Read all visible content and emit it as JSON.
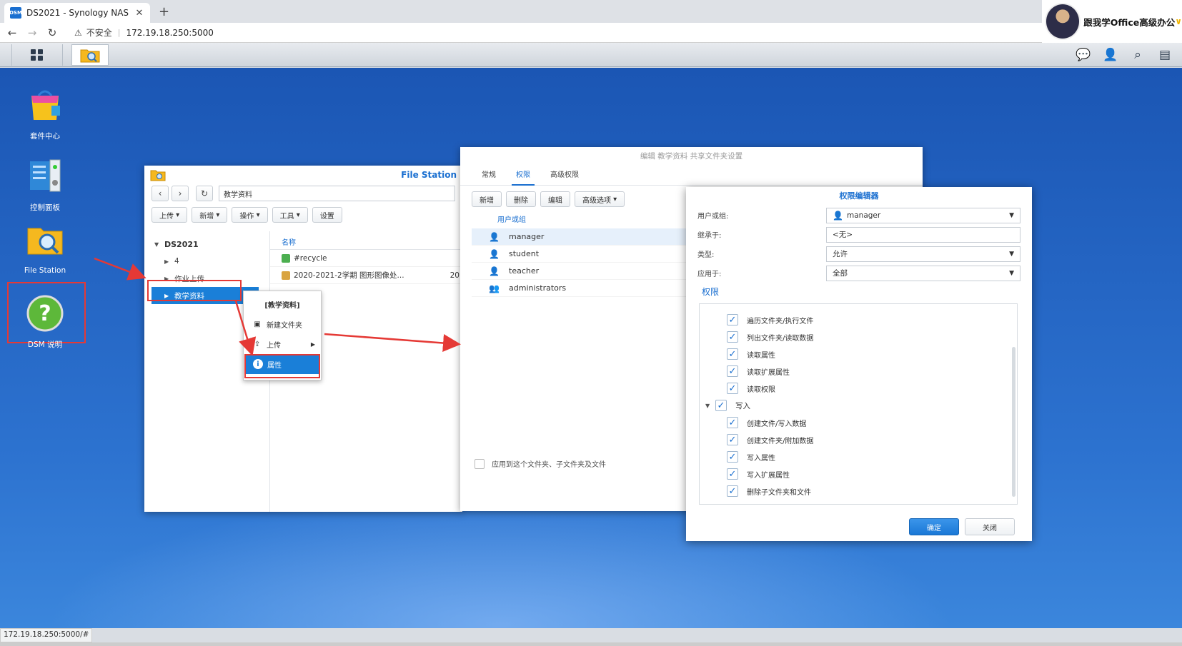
{
  "browser": {
    "tab_title": "DS2021 - Synology NAS",
    "favicon_text": "DSM",
    "insecure_label": "不安全",
    "url": "172.19.18.250:5000",
    "status_url": "172.19.18.250:5000/#"
  },
  "profile": {
    "name": "跟我学Office高级办公"
  },
  "desktop": {
    "icons": [
      {
        "label": "套件中心"
      },
      {
        "label": "控制面板"
      },
      {
        "label": "File Station"
      },
      {
        "label": "DSM 说明"
      }
    ]
  },
  "file_station": {
    "title": "File Station",
    "path": "教学资料",
    "toolbar": [
      "上传",
      "新增",
      "操作",
      "工具",
      "设置"
    ],
    "tree": {
      "root": "DS2021",
      "children": [
        "4",
        "作业上传",
        "教学资料"
      ]
    },
    "column_name": "名称",
    "files": [
      {
        "name": "#recycle"
      },
      {
        "name": "2020-2021-2学期 图形图像处...",
        "extra": "20"
      }
    ]
  },
  "context_menu": {
    "title": "[教学资料]",
    "items": [
      "新建文件夹",
      "上传",
      "属性"
    ]
  },
  "settings": {
    "title": "编辑 教学资料 共享文件夹设置",
    "tabs": [
      "常规",
      "权限",
      "高级权限"
    ],
    "toolbar": [
      "新增",
      "删除",
      "编辑",
      "高级选项"
    ],
    "list_header": "用户或组",
    "users": [
      "manager",
      "student",
      "teacher",
      "administrators"
    ],
    "apply_label": "应用到这个文件夹、子文件夹及文件"
  },
  "perm_editor": {
    "title": "权限编辑器",
    "fields": [
      {
        "label": "用户或组:",
        "value": "manager"
      },
      {
        "label": "继承于:",
        "value": "<无>"
      },
      {
        "label": "类型:",
        "value": "允许"
      },
      {
        "label": "应用于:",
        "value": "全部"
      }
    ],
    "section": "权限",
    "read_items": [
      "遍历文件夹/执行文件",
      "列出文件夹/读取数据",
      "读取属性",
      "读取扩展属性",
      "读取权限"
    ],
    "write_group": "写入",
    "write_items": [
      "创建文件/写入数据",
      "创建文件夹/附加数据",
      "写入属性",
      "写入扩展属性",
      "删除子文件夹和文件"
    ],
    "ok_label": "确定",
    "close_label": "关闭"
  },
  "colors": {
    "accent": "#1a7fd8",
    "highlight": "#e53935",
    "desktop": "#2566c4"
  }
}
